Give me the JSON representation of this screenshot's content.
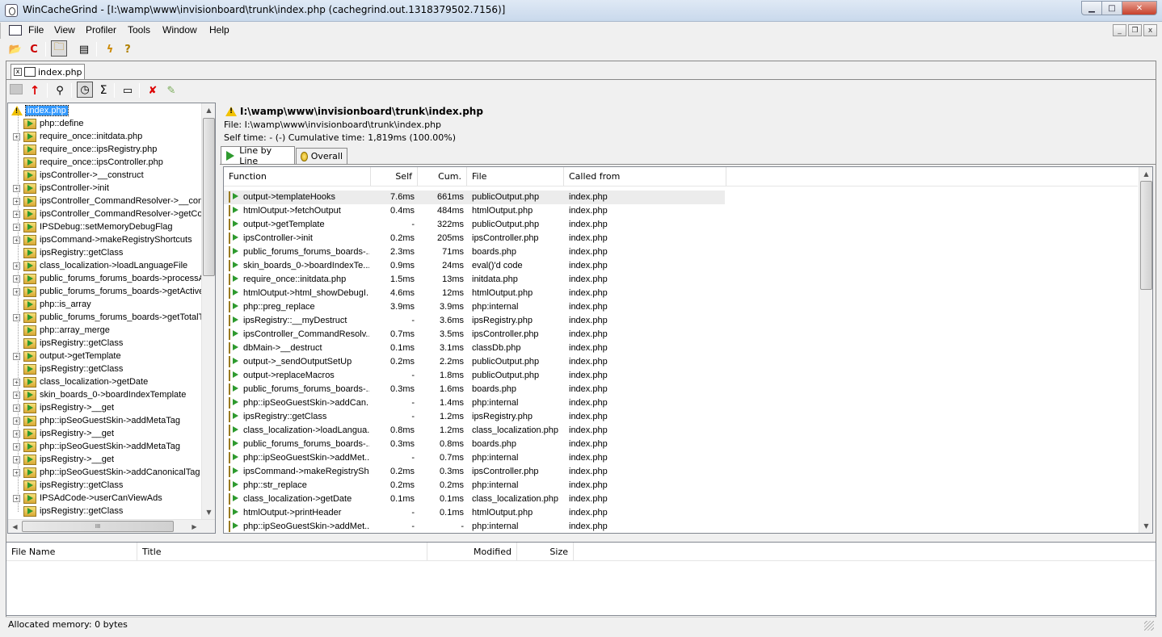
{
  "window": {
    "title": "WinCacheGrind - [I:\\wamp\\www\\invisionboard\\trunk\\index.php (cachegrind.out.1318379502.7156)]",
    "min_glyph": "▁",
    "max_glyph": "□",
    "close_glyph": "✕"
  },
  "menu": [
    {
      "label": "File"
    },
    {
      "label": "View"
    },
    {
      "label": "Profiler"
    },
    {
      "label": "Tools"
    },
    {
      "label": "Window"
    },
    {
      "label": "Help"
    }
  ],
  "mdi": {
    "min_glyph": "_",
    "restore_glyph": "❐",
    "close_glyph": "x"
  },
  "toolbar": {
    "open_glyph": "📂",
    "reload_glyph": "C",
    "folder_glyph": "🗀",
    "properties_glyph": "▤",
    "lightning_glyph": "ϟ",
    "help_glyph": "?"
  },
  "doc_tab": {
    "label": "index.php",
    "close_glyph": "x"
  },
  "toolbar2": {
    "up_glyph": "↑",
    "find_glyph": "⚲",
    "time_glyph": "◷",
    "sum_glyph": "Σ",
    "grid_glyph": "▭",
    "remove_glyph": "✘",
    "export_glyph": "✎"
  },
  "tree": {
    "root": "index.php",
    "items": [
      {
        "label": "php::define",
        "expandable": false
      },
      {
        "label": "require_once::initdata.php",
        "expandable": true
      },
      {
        "label": "require_once::ipsRegistry.php",
        "expandable": false
      },
      {
        "label": "require_once::ipsController.php",
        "expandable": false
      },
      {
        "label": "ipsController->__construct",
        "expandable": false
      },
      {
        "label": "ipsController->init",
        "expandable": true
      },
      {
        "label": "ipsController_CommandResolver->__cons",
        "expandable": true
      },
      {
        "label": "ipsController_CommandResolver->getCom",
        "expandable": true
      },
      {
        "label": "IPSDebug::setMemoryDebugFlag",
        "expandable": true
      },
      {
        "label": "ipsCommand->makeRegistryShortcuts",
        "expandable": true
      },
      {
        "label": "ipsRegistry::getClass",
        "expandable": false
      },
      {
        "label": "class_localization->loadLanguageFile",
        "expandable": true
      },
      {
        "label": "public_forums_forums_boards->processAll",
        "expandable": true
      },
      {
        "label": "public_forums_forums_boards->getActiveU",
        "expandable": true
      },
      {
        "label": "php::is_array",
        "expandable": false
      },
      {
        "label": "public_forums_forums_boards->getTotalTe",
        "expandable": true
      },
      {
        "label": "php::array_merge",
        "expandable": false
      },
      {
        "label": "ipsRegistry::getClass",
        "expandable": false
      },
      {
        "label": "output->getTemplate",
        "expandable": true
      },
      {
        "label": "ipsRegistry::getClass",
        "expandable": false
      },
      {
        "label": "class_localization->getDate",
        "expandable": true
      },
      {
        "label": "skin_boards_0->boardIndexTemplate",
        "expandable": true
      },
      {
        "label": "ipsRegistry->__get",
        "expandable": true
      },
      {
        "label": "php::ipSeoGuestSkin->addMetaTag",
        "expandable": true
      },
      {
        "label": "ipsRegistry->__get",
        "expandable": true
      },
      {
        "label": "php::ipSeoGuestSkin->addMetaTag",
        "expandable": true
      },
      {
        "label": "ipsRegistry->__get",
        "expandable": true
      },
      {
        "label": "php::ipSeoGuestSkin->addCanonicalTag",
        "expandable": true
      },
      {
        "label": "ipsRegistry::getClass",
        "expandable": false
      },
      {
        "label": "IPSAdCode->userCanViewAds",
        "expandable": true
      },
      {
        "label": "ipsRegistry::getClass",
        "expandable": false
      }
    ],
    "hscroll_grip": "III"
  },
  "header": {
    "title": "I:\\wamp\\www\\invisionboard\\trunk\\index.php",
    "file_line": "File: I:\\wamp\\www\\invisionboard\\trunk\\index.php",
    "time_line": "Self time: - (-)   Cumulative time: 1,819ms (100.00%)"
  },
  "subtabs": [
    {
      "label": "Line by Line",
      "active": true
    },
    {
      "label": "Overall",
      "active": false
    }
  ],
  "grid": {
    "columns": [
      "Function",
      "Self",
      "Cum.",
      "File",
      "Called from"
    ],
    "rows": [
      [
        "output->templateHooks",
        "7.6ms",
        "661ms",
        "publicOutput.php",
        "index.php"
      ],
      [
        "htmlOutput->fetchOutput",
        "0.4ms",
        "484ms",
        "htmlOutput.php",
        "index.php"
      ],
      [
        "output->getTemplate",
        "-",
        "322ms",
        "publicOutput.php",
        "index.php"
      ],
      [
        "ipsController->init",
        "0.2ms",
        "205ms",
        "ipsController.php",
        "index.php"
      ],
      [
        "public_forums_forums_boards-...",
        "2.3ms",
        "71ms",
        "boards.php",
        "index.php"
      ],
      [
        "skin_boards_0->boardIndexTe...",
        "0.9ms",
        "24ms",
        " eval()'d code",
        "index.php"
      ],
      [
        "require_once::initdata.php",
        "1.5ms",
        "13ms",
        "initdata.php",
        "index.php"
      ],
      [
        "htmlOutput->html_showDebugI...",
        "4.6ms",
        "12ms",
        "htmlOutput.php",
        "index.php"
      ],
      [
        "php::preg_replace",
        "3.9ms",
        "3.9ms",
        "php:internal",
        "index.php"
      ],
      [
        "ipsRegistry::__myDestruct",
        "-",
        "3.6ms",
        "ipsRegistry.php",
        "index.php"
      ],
      [
        "ipsController_CommandResolv...",
        "0.7ms",
        "3.5ms",
        "ipsController.php",
        "index.php"
      ],
      [
        "dbMain->__destruct",
        "0.1ms",
        "3.1ms",
        "classDb.php",
        "index.php"
      ],
      [
        "output->_sendOutputSetUp",
        "0.2ms",
        "2.2ms",
        "publicOutput.php",
        "index.php"
      ],
      [
        "output->replaceMacros",
        "-",
        "1.8ms",
        "publicOutput.php",
        "index.php"
      ],
      [
        "public_forums_forums_boards-...",
        "0.3ms",
        "1.6ms",
        "boards.php",
        "index.php"
      ],
      [
        "php::ipSeoGuestSkin->addCan...",
        "-",
        "1.4ms",
        "php:internal",
        "index.php"
      ],
      [
        "ipsRegistry::getClass",
        "-",
        "1.2ms",
        "ipsRegistry.php",
        "index.php"
      ],
      [
        "class_localization->loadLangua...",
        "0.8ms",
        "1.2ms",
        "class_localization.php",
        "index.php"
      ],
      [
        "public_forums_forums_boards-...",
        "0.3ms",
        "0.8ms",
        "boards.php",
        "index.php"
      ],
      [
        "php::ipSeoGuestSkin->addMet...",
        "-",
        "0.7ms",
        "php:internal",
        "index.php"
      ],
      [
        "ipsCommand->makeRegistrySh...",
        "0.2ms",
        "0.3ms",
        "ipsController.php",
        "index.php"
      ],
      [
        "php::str_replace",
        "0.2ms",
        "0.2ms",
        "php:internal",
        "index.php"
      ],
      [
        "class_localization->getDate",
        "0.1ms",
        "0.1ms",
        "class_localization.php",
        "index.php"
      ],
      [
        "htmlOutput->printHeader",
        "-",
        "0.1ms",
        "htmlOutput.php",
        "index.php"
      ],
      [
        "php::ipSeoGuestSkin->addMet...",
        "-",
        "-",
        "php:internal",
        "index.php"
      ]
    ],
    "selected_row": 0
  },
  "files": {
    "columns": [
      "File Name",
      "Title",
      "Modified",
      "Size"
    ]
  },
  "scroll": {
    "up": "▲",
    "down": "▼",
    "left": "◀",
    "right": "▶"
  },
  "status": {
    "text": "Allocated memory: 0 bytes"
  }
}
